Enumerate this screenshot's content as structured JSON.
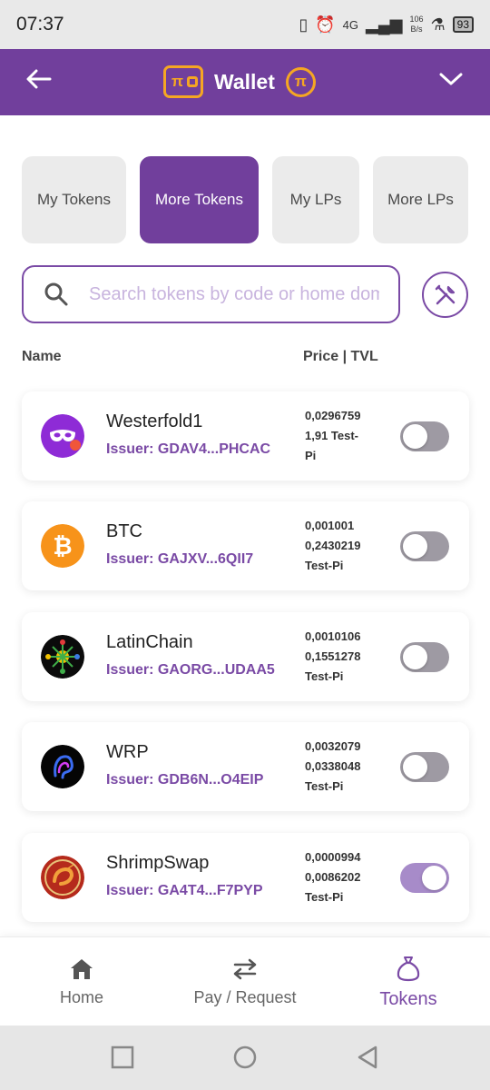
{
  "status_bar": {
    "time": "07:37",
    "net_speed_value": "106",
    "net_speed_unit": "B/s",
    "network": "4G",
    "battery": "93"
  },
  "header": {
    "title": "Wallet"
  },
  "tabs": [
    {
      "label": "My Tokens",
      "active": false
    },
    {
      "label": "More Tokens",
      "active": true
    },
    {
      "label": "My LPs",
      "active": false
    },
    {
      "label": "More LPs",
      "active": false
    }
  ],
  "search": {
    "placeholder": "Search tokens by code or home domain"
  },
  "columns": {
    "name": "Name",
    "price": "Price | TVL"
  },
  "tokens": [
    {
      "name": "Westerfold1",
      "issuer": "Issuer: GDAV4...PHCAC",
      "price_lines": [
        "0,0296759",
        "1,91 Test-",
        "Pi"
      ],
      "enabled": false,
      "logo": "mask-icon"
    },
    {
      "name": "BTC",
      "issuer": "Issuer: GAJXV...6QII7",
      "price_lines": [
        "0,001001",
        "0,2430219",
        "Test-Pi"
      ],
      "enabled": false,
      "logo": "bitcoin-icon"
    },
    {
      "name": "LatinChain",
      "issuer": "Issuer: GAORG...UDAA5",
      "price_lines": [
        "0,0010106",
        "0,1551278",
        "Test-Pi"
      ],
      "enabled": false,
      "logo": "latinchain-icon"
    },
    {
      "name": "WRP",
      "issuer": "Issuer: GDB6N...O4EIP",
      "price_lines": [
        "0,0032079",
        "0,0338048",
        "Test-Pi"
      ],
      "enabled": false,
      "logo": "wrp-icon"
    },
    {
      "name": "ShrimpSwap",
      "issuer": "Issuer: GA4T4...F7PYP",
      "price_lines": [
        "0,0000994",
        "0,0086202",
        "Test-Pi"
      ],
      "enabled": true,
      "logo": "shrimp-icon"
    }
  ],
  "bottom_nav": {
    "home": "Home",
    "pay": "Pay / Request",
    "tokens": "Tokens"
  },
  "colors": {
    "primary": "#713f9c",
    "accent": "#f5a623",
    "issuer": "#7a4aa5"
  }
}
